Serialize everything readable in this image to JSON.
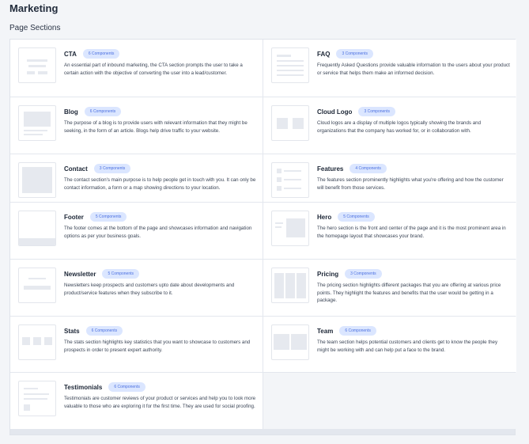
{
  "page": {
    "title": "Marketing",
    "section_title": "Page Sections"
  },
  "sections": [
    {
      "name": "CTA",
      "badge": "6 Components",
      "thumb_icon": "cta-thumbnail-icon",
      "desc": "An essential part of inbound marketing, the CTA section prompts the user to take a certain action with the objective of converting the user into a lead/customer."
    },
    {
      "name": "FAQ",
      "badge": "3 Components",
      "thumb_icon": "faq-thumbnail-icon",
      "desc": "Frequently Asked Questions provide valuable information to the users about your product or service that helps them make an informed decision."
    },
    {
      "name": "Blog",
      "badge": "6 Components",
      "thumb_icon": "blog-thumbnail-icon",
      "desc": "The purpose of a blog is to provide users with relevant information that they might be seeking, in the form of an article. Blogs help drive traffic to your website."
    },
    {
      "name": "Cloud Logo",
      "badge": "3 Components",
      "thumb_icon": "cloud-logo-thumbnail-icon",
      "desc": "Cloud logos are a display of multiple logos typically showing the brands and organizations that the company has worked for, or in collaboration with."
    },
    {
      "name": "Contact",
      "badge": "3 Components",
      "thumb_icon": "contact-thumbnail-icon",
      "desc": "The contact section's main purpose is to help people get in touch with you. It can only be contact information, a form or a map showing directions to your location."
    },
    {
      "name": "Features",
      "badge": "4 Components",
      "thumb_icon": "features-thumbnail-icon",
      "desc": "The features section prominently highlights what you're offering and how the customer will benefit from those services."
    },
    {
      "name": "Footer",
      "badge": "5 Components",
      "thumb_icon": "footer-thumbnail-icon",
      "desc": "The footer comes at the bottom of the page and showcases information and navigation options as per your business goals."
    },
    {
      "name": "Hero",
      "badge": "5 Components",
      "thumb_icon": "hero-thumbnail-icon",
      "desc": "The hero section is the front and center of the page and it is the most prominent area in the homepage layout that showcases your brand."
    },
    {
      "name": "Newsletter",
      "badge": "5 Components",
      "thumb_icon": "newsletter-thumbnail-icon",
      "desc": "Newsletters keep prospects and customers upto date about developments and product/service features when they subscribe to it."
    },
    {
      "name": "Pricing",
      "badge": "3 Components",
      "thumb_icon": "pricing-thumbnail-icon",
      "desc": "The pricing section highlights different packages that you are offering at various price points. They highlight the features and benefits that the user would be getting in a package."
    },
    {
      "name": "Stats",
      "badge": "6 Components",
      "thumb_icon": "stats-thumbnail-icon",
      "desc": "The stats section highlights key statistics that you want to showcase to customers and prospects in order to present expert authority."
    },
    {
      "name": "Team",
      "badge": "6 Components",
      "thumb_icon": "team-thumbnail-icon",
      "desc": "The team section helps potential customers and clients get to know the people they might be working with and can help put a face to the brand."
    },
    {
      "name": "Testimonials",
      "badge": "6 Components",
      "thumb_icon": "testimonials-thumbnail-icon",
      "desc": "Testimonials are customer reviews of your product or services and help you to look more valuable to those who are exploring it for the first time. They are used for social proofing."
    }
  ],
  "colors": {
    "badge_bg": "#dbe6ff",
    "badge_text": "#4a6fe0",
    "page_bg": "#f3f5f8",
    "card_bg": "#ffffff"
  }
}
